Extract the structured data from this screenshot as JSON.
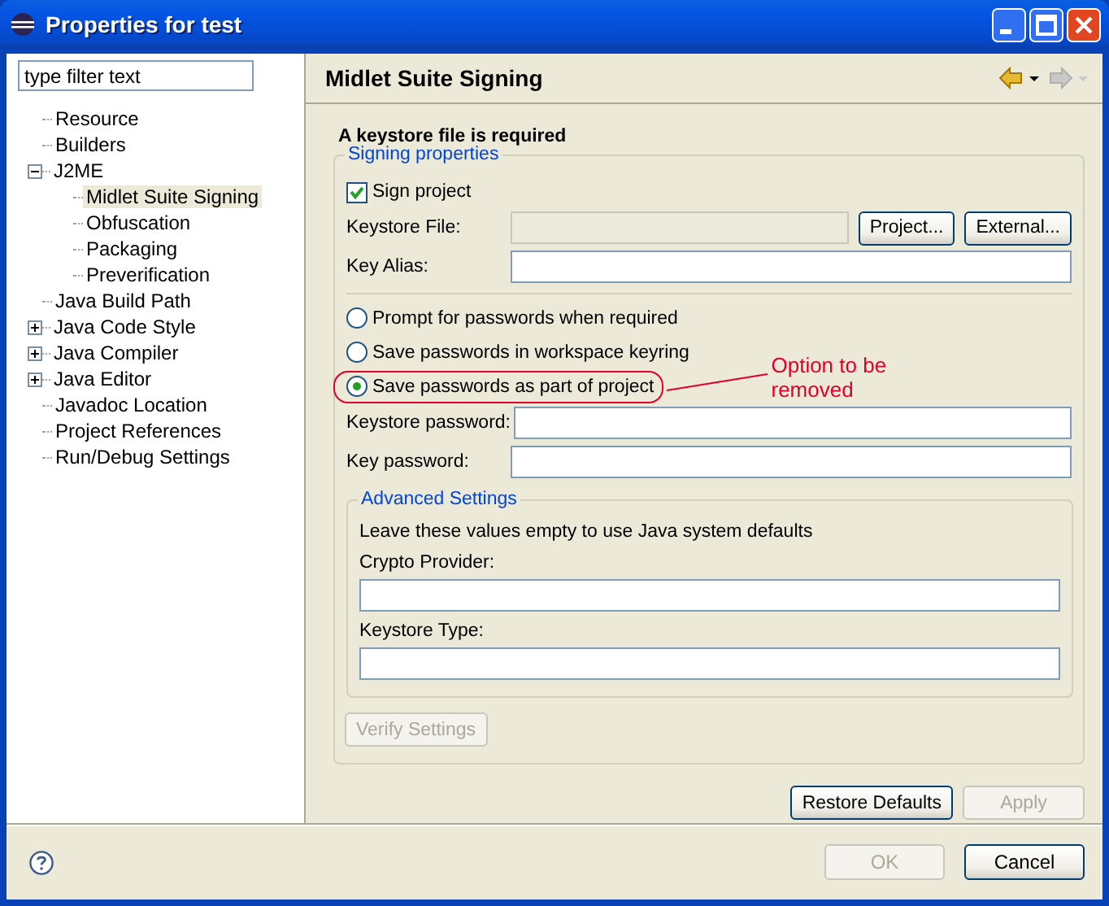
{
  "window": {
    "title": "Properties for test"
  },
  "filter": {
    "placeholder": "type filter text"
  },
  "tree": [
    {
      "label": "Resource",
      "selected": false
    },
    {
      "label": "Builders",
      "selected": false
    },
    {
      "label": "J2ME",
      "selected": false,
      "expanded": true,
      "children": [
        {
          "label": "Midlet Suite Signing",
          "selected": true
        },
        {
          "label": "Obfuscation",
          "selected": false
        },
        {
          "label": "Packaging",
          "selected": false
        },
        {
          "label": "Preverification",
          "selected": false
        }
      ]
    },
    {
      "label": "Java Build Path",
      "selected": false
    },
    {
      "label": "Java Code Style",
      "selected": false,
      "expanded": false
    },
    {
      "label": "Java Compiler",
      "selected": false,
      "expanded": false
    },
    {
      "label": "Java Editor",
      "selected": false,
      "expanded": false
    },
    {
      "label": "Javadoc Location",
      "selected": false
    },
    {
      "label": "Project References",
      "selected": false
    },
    {
      "label": "Run/Debug Settings",
      "selected": false
    }
  ],
  "page": {
    "title": "Midlet Suite Signing",
    "nav": [
      {
        "kind": "back",
        "disabled": false
      },
      {
        "kind": "forward",
        "disabled": true
      }
    ],
    "message": "A keystore file is required",
    "signing": {
      "legend": "Signing properties",
      "sign_project": {
        "label": "Sign project",
        "checked": true
      },
      "keystore_file": {
        "label": "Keystore File:",
        "disabled": true,
        "buttons": [
          "Project...",
          "External..."
        ]
      },
      "key_alias": {
        "label": "Key Alias:"
      },
      "password_options": [
        {
          "label": "Prompt for passwords when required",
          "selected": false,
          "circled": false
        },
        {
          "label": "Save passwords in workspace keyring",
          "selected": false,
          "circled": false
        },
        {
          "label": "Save passwords as part of project",
          "selected": true,
          "circled": true
        }
      ],
      "annotation": "Option to be removed",
      "keystore_password": {
        "label": "Keystore password:"
      },
      "key_password": {
        "label": "Key password:"
      },
      "advanced": {
        "legend": "Advanced Settings",
        "note": "Leave these values empty to use Java system defaults",
        "crypto_provider": {
          "label": "Crypto Provider:"
        },
        "keystore_type": {
          "label": "Keystore Type:"
        }
      },
      "verify_button": {
        "label": "Verify Settings",
        "disabled": true
      }
    },
    "buttons": [
      {
        "label": "Restore Defaults",
        "disabled": false
      },
      {
        "label": "Apply",
        "disabled": true
      }
    ]
  },
  "footer": {
    "buttons": [
      {
        "label": "OK",
        "disabled": true
      },
      {
        "label": "Cancel",
        "disabled": false
      }
    ]
  }
}
